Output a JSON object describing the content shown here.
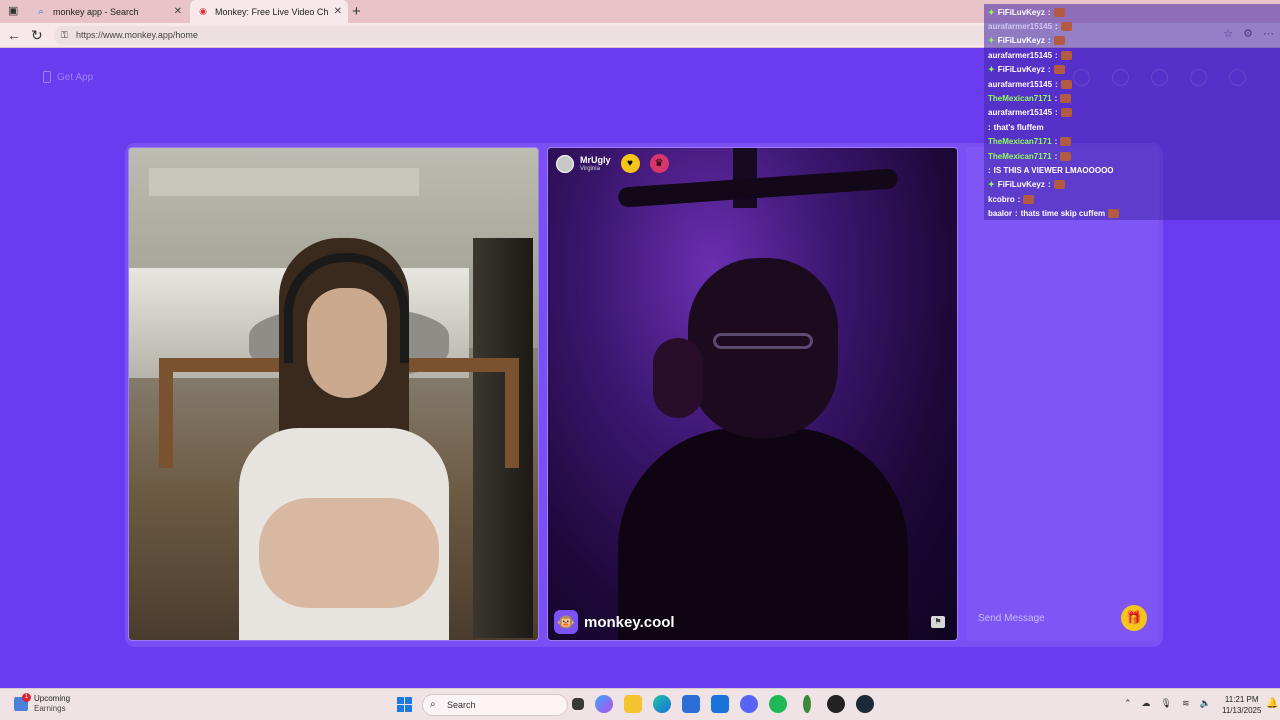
{
  "browser": {
    "tabs": [
      {
        "title": "monkey app - Search",
        "icon": "search-icon"
      },
      {
        "title": "Monkey: Free Live Video Ch",
        "icon": "record-icon"
      }
    ],
    "url": "https://www.monkey.app/home"
  },
  "page": {
    "get_app_label": "Get App",
    "peer": {
      "name": "MrUgly",
      "location": "Virginia"
    },
    "watermark": "monkey.cool",
    "send_placeholder": "Send Message"
  },
  "overlay_chat": [
    {
      "user": "FiFiLuvKeyz",
      "color": "white",
      "sparkle": true,
      "text": "",
      "emote": true
    },
    {
      "user": "aurafarmer15145",
      "color": "grey",
      "sparkle": false,
      "text": "",
      "emote": true
    },
    {
      "user": "FiFiLuvKeyz",
      "color": "white",
      "sparkle": true,
      "text": "",
      "emote": true
    },
    {
      "user": "aurafarmer15145",
      "color": "white",
      "sparkle": false,
      "text": "",
      "emote": true
    },
    {
      "user": "FiFiLuvKeyz",
      "color": "white",
      "sparkle": true,
      "text": "",
      "emote": true
    },
    {
      "user": "aurafarmer15145",
      "color": "white",
      "sparkle": false,
      "text": "",
      "emote": true
    },
    {
      "user": "TheMexican7171",
      "color": "green",
      "sparkle": false,
      "text": "",
      "emote": true
    },
    {
      "user": "aurafarmer15145",
      "color": "white",
      "sparkle": false,
      "text": "",
      "emote": true
    },
    {
      "user": "",
      "color": "red",
      "sparkle": false,
      "text": "that's fluffem",
      "emote": false
    },
    {
      "user": "TheMexican7171",
      "color": "green",
      "sparkle": false,
      "text": "",
      "emote": true
    },
    {
      "user": "TheMexican7171",
      "color": "green",
      "sparkle": false,
      "text": "",
      "emote": true
    },
    {
      "user": "",
      "color": "grey",
      "sparkle": false,
      "text": "IS THIS A VIEWER LMAOOOOO",
      "emote": false
    },
    {
      "user": "FiFiLuvKeyz",
      "color": "white",
      "sparkle": true,
      "text": "",
      "emote": true
    },
    {
      "user": "kcobro",
      "color": "white",
      "sparkle": false,
      "text": "",
      "emote": true
    },
    {
      "user": "baalor",
      "color": "white",
      "sparkle": false,
      "text": "thats time skip cuffem",
      "emote": true
    }
  ],
  "taskbar": {
    "weather_title": "Upcoming",
    "weather_sub": "Earnings",
    "notification_count": "1",
    "search_label": "Search",
    "time": "11:21 PM",
    "date": "11/13/2025"
  },
  "colors": {
    "page_bg": "#6a3cf0",
    "gift": "#f6c51c",
    "chat_green": "#8dff5a",
    "chat_red": "#ff3b3b"
  }
}
